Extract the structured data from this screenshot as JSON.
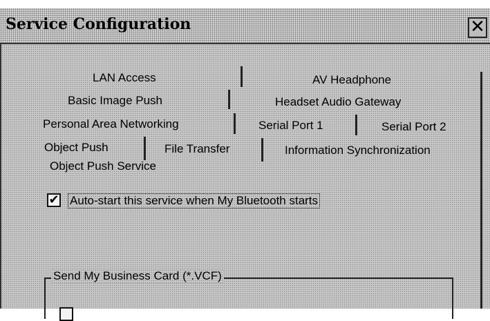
{
  "window": {
    "title": "Service Configuration",
    "close_label": "✕"
  },
  "tabs": {
    "row1": [
      "LAN Access",
      "AV Headphone"
    ],
    "row2": [
      "Basic Image Push",
      "Headset Audio Gateway"
    ],
    "row3": [
      "Personal Area Networking",
      "Serial Port 1",
      "Serial Port 2"
    ],
    "row4": [
      "Object Push",
      "File Transfer",
      "Information Synchronization"
    ],
    "selected": "Object Push"
  },
  "panel": {
    "service_title": "Object Push Service",
    "autostart": {
      "label": "Auto-start this service when My Bluetooth starts",
      "checked": true,
      "check_glyph": "✔"
    },
    "business_card_group": {
      "legend": "Send My Business Card (*.VCF)",
      "checked": false
    }
  }
}
